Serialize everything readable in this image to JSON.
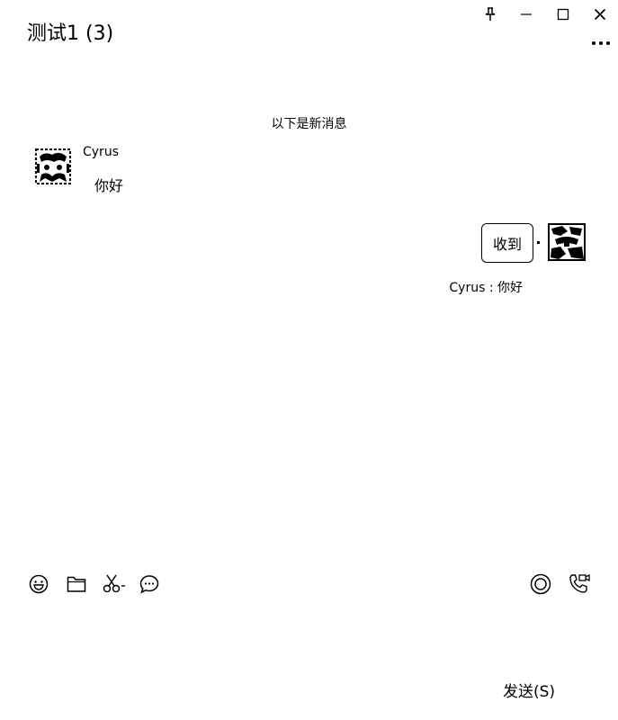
{
  "window": {
    "title": "测试1 (3)",
    "controls": [
      "pin-icon",
      "minimize-icon",
      "maximize-icon",
      "close-icon"
    ],
    "more_icon": "more-icon"
  },
  "chat": {
    "new_messages_divider": "以下是新消息",
    "messages": [
      {
        "side": "left",
        "sender": "Cyrus",
        "text": "你好"
      },
      {
        "side": "right",
        "text": "收到",
        "quote": "Cyrus : 你好"
      }
    ]
  },
  "toolbar": {
    "left_icons": [
      "emoji-icon",
      "folder-icon",
      "scissors-icon",
      "chat-bubble-icon"
    ],
    "right_icons": [
      "live-icon",
      "phone-video-icon"
    ]
  },
  "input": {
    "send_label": "发送(S)"
  }
}
